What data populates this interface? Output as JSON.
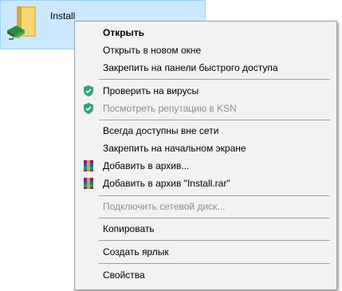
{
  "file": {
    "name": "Install",
    "icon": "folder-shortcut-icon"
  },
  "menu": {
    "open": "Открыть",
    "open_new_window": "Открыть в новом окне",
    "pin_quick_access": "Закрепить на панели быстрого доступа",
    "scan_viruses": "Проверить на вирусы",
    "check_reputation": "Посмотреть репутацию в KSN",
    "always_offline": "Всегда доступны вне сети",
    "pin_start": "Закрепить на начальном экране",
    "add_archive": "Добавить в архив...",
    "add_archive_named": "Добавить в архив \"Install.rar\"",
    "map_drive": "Подключить сетевой диск...",
    "copy": "Копировать",
    "create_shortcut": "Создать ярлык",
    "properties": "Свойства"
  },
  "colors": {
    "selection_bg": "#cce8ff",
    "selection_border": "#99d1ff",
    "menu_bg": "#f2f2f2",
    "disabled_text": "#8d8d8d",
    "kaspersky_green": "#2fa27a"
  }
}
